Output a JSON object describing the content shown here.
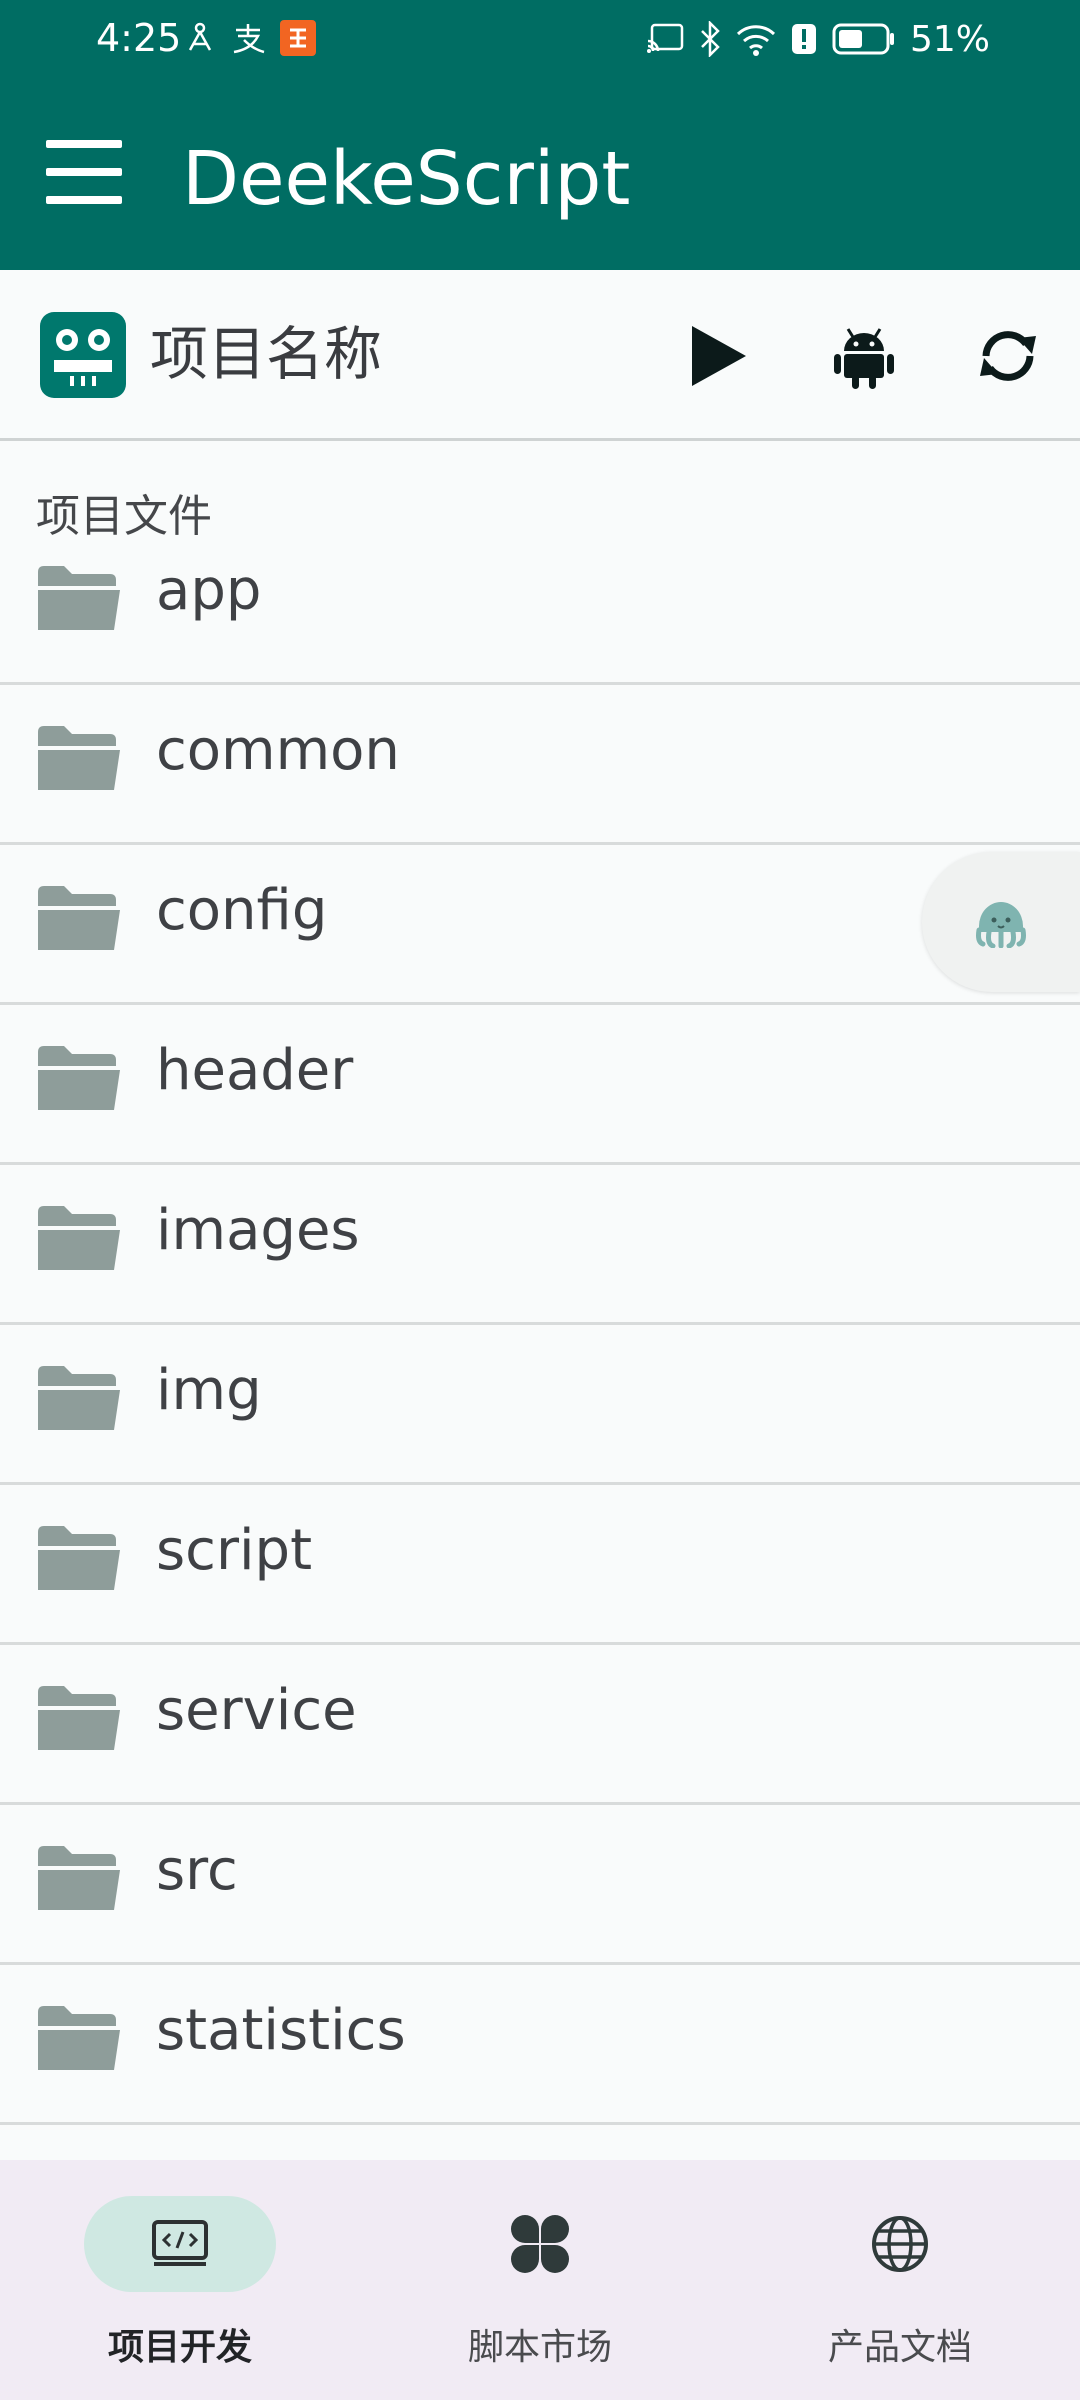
{
  "status_bar": {
    "time": "4:25",
    "left_icons": [
      "hotspot-icon",
      "pay-icon",
      "app-badge-icon"
    ],
    "right_icons": [
      "cast-icon",
      "bluetooth-icon",
      "wifi-icon",
      "alert-icon",
      "battery-icon"
    ],
    "battery_percent": "51%",
    "battery_level": 0.51
  },
  "app_bar": {
    "title": "DeekeScript",
    "menu_icon": "menu-icon",
    "background_color": "#006d63"
  },
  "project": {
    "name": "项目名称",
    "actions": [
      {
        "name": "run",
        "icon": "play-icon"
      },
      {
        "name": "android",
        "icon": "android-icon"
      },
      {
        "name": "sync",
        "icon": "sync-icon"
      }
    ]
  },
  "files": {
    "section_label": "项目文件",
    "items": [
      "app",
      "common",
      "config",
      "header",
      "images",
      "img",
      "script",
      "service",
      "src",
      "statistics"
    ]
  },
  "bottom_nav": {
    "items": [
      {
        "label": "项目开发",
        "icon": "code-monitor-icon",
        "active": true
      },
      {
        "label": "脚本市场",
        "icon": "clover-icon",
        "active": false
      },
      {
        "label": "产品文档",
        "icon": "globe-icon",
        "active": false
      }
    ],
    "active_color": "#cfe8e2"
  }
}
